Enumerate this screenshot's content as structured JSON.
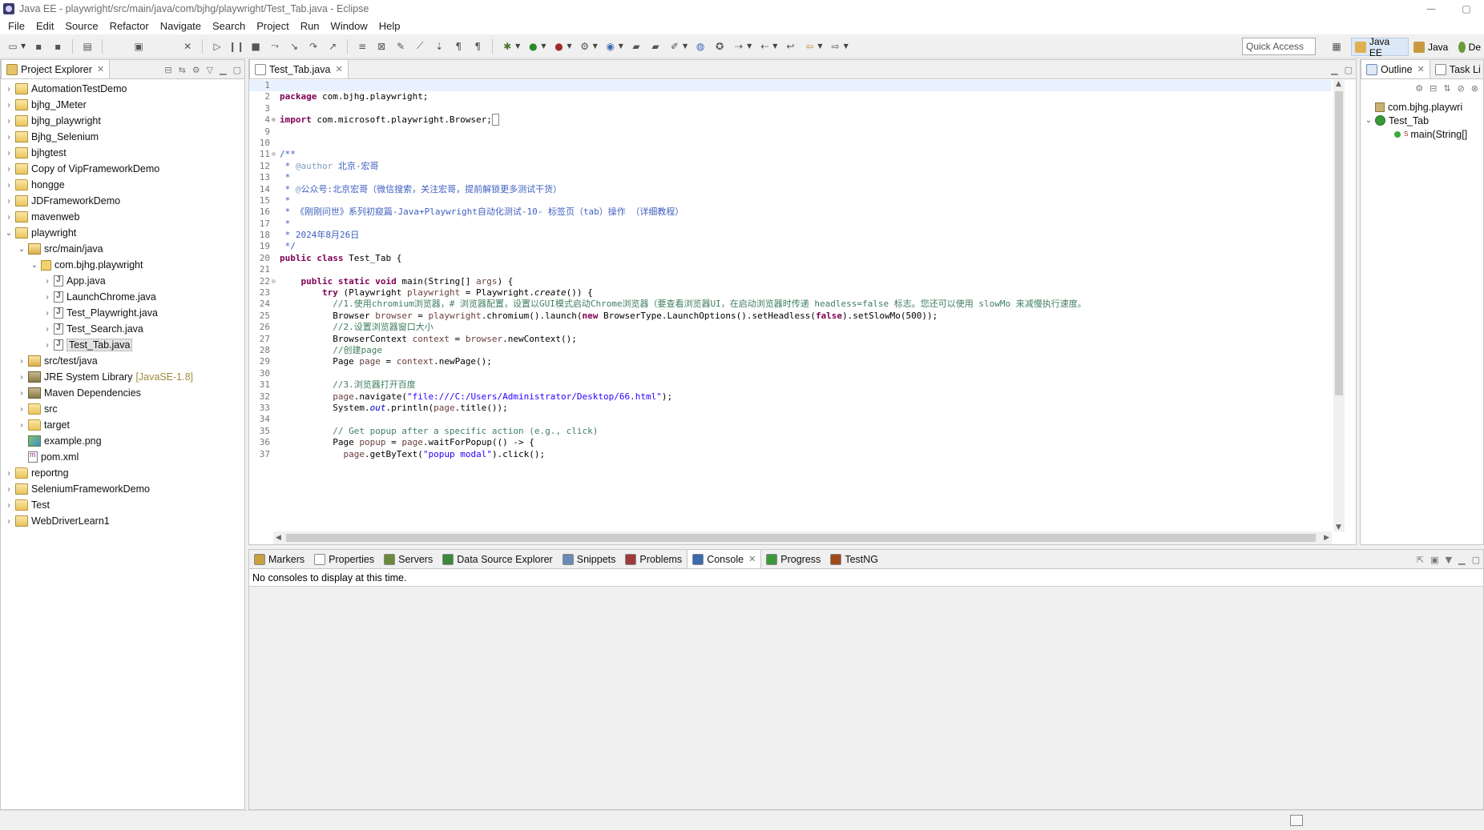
{
  "window": {
    "title": "Java EE - playwright/src/main/java/com/bjhg/playwright/Test_Tab.java - Eclipse",
    "minimize": "—",
    "maximize": "▢"
  },
  "menu": [
    "File",
    "Edit",
    "Source",
    "Refactor",
    "Navigate",
    "Search",
    "Project",
    "Run",
    "Window",
    "Help"
  ],
  "toolbar": {
    "quick_access_placeholder": "Quick Access",
    "perspectives": [
      {
        "label": "Java EE",
        "active": true
      },
      {
        "label": "Java",
        "active": false
      },
      {
        "label": "De",
        "active": false
      }
    ]
  },
  "project_explorer": {
    "tab_label": "Project Explorer",
    "items": [
      {
        "label": "AutomationTestDemo",
        "depth": 0,
        "arrow": "›",
        "icon": "project"
      },
      {
        "label": "bjhg_JMeter",
        "depth": 0,
        "arrow": "›",
        "icon": "project"
      },
      {
        "label": "bjhg_playwright",
        "depth": 0,
        "arrow": "›",
        "icon": "project"
      },
      {
        "label": "Bjhg_Selenium",
        "depth": 0,
        "arrow": "›",
        "icon": "project-err"
      },
      {
        "label": "bjhgtest",
        "depth": 0,
        "arrow": "›",
        "icon": "project"
      },
      {
        "label": "Copy of VipFrameworkDemo",
        "depth": 0,
        "arrow": "›",
        "icon": "project"
      },
      {
        "label": "hongge",
        "depth": 0,
        "arrow": "›",
        "icon": "folder"
      },
      {
        "label": "JDFrameworkDemo",
        "depth": 0,
        "arrow": "›",
        "icon": "project"
      },
      {
        "label": "mavenweb",
        "depth": 0,
        "arrow": "›",
        "icon": "project"
      },
      {
        "label": "playwright",
        "depth": 0,
        "arrow": "⌄",
        "icon": "project"
      },
      {
        "label": "src/main/java",
        "depth": 1,
        "arrow": "⌄",
        "icon": "srcfolder"
      },
      {
        "label": "com.bjhg.playwright",
        "depth": 2,
        "arrow": "⌄",
        "icon": "package"
      },
      {
        "label": "App.java",
        "depth": 3,
        "arrow": "›",
        "icon": "java"
      },
      {
        "label": "LaunchChrome.java",
        "depth": 3,
        "arrow": "›",
        "icon": "java"
      },
      {
        "label": "Test_Playwright.java",
        "depth": 3,
        "arrow": "›",
        "icon": "java"
      },
      {
        "label": "Test_Search.java",
        "depth": 3,
        "arrow": "›",
        "icon": "java"
      },
      {
        "label": "Test_Tab.java",
        "depth": 3,
        "arrow": "›",
        "icon": "java",
        "selected": true
      },
      {
        "label": "src/test/java",
        "depth": 1,
        "arrow": "›",
        "icon": "srcfolder"
      },
      {
        "label": "JRE System Library",
        "extra": "[JavaSE-1.8]",
        "depth": 1,
        "arrow": "›",
        "icon": "lib"
      },
      {
        "label": "Maven Dependencies",
        "depth": 1,
        "arrow": "›",
        "icon": "lib"
      },
      {
        "label": "src",
        "depth": 1,
        "arrow": "›",
        "icon": "folder"
      },
      {
        "label": "target",
        "depth": 1,
        "arrow": "›",
        "icon": "folder"
      },
      {
        "label": "example.png",
        "depth": 1,
        "arrow": "",
        "icon": "img"
      },
      {
        "label": "pom.xml",
        "depth": 1,
        "arrow": "",
        "icon": "xml"
      },
      {
        "label": "reportng",
        "depth": 0,
        "arrow": "›",
        "icon": "folder"
      },
      {
        "label": "SeleniumFrameworkDemo",
        "depth": 0,
        "arrow": "›",
        "icon": "project"
      },
      {
        "label": "Test",
        "depth": 0,
        "arrow": "›",
        "icon": "folder"
      },
      {
        "label": "WebDriverLearn1",
        "depth": 0,
        "arrow": "›",
        "icon": "project"
      }
    ]
  },
  "editor": {
    "tab_label": "Test_Tab.java",
    "lines": [
      {
        "n": "1",
        "fold": "",
        "html": ""
      },
      {
        "n": "2",
        "fold": "",
        "html": "<span class=\"kw\">package</span> com.bjhg.playwright;"
      },
      {
        "n": "3",
        "fold": "",
        "html": ""
      },
      {
        "n": "4",
        "fold": "⊕",
        "html": "<span class=\"kw\">import</span> com.microsoft.playwright.Browser;<span style=\"border:1px solid #888\">&nbsp;</span>"
      },
      {
        "n": "9",
        "fold": "",
        "html": ""
      },
      {
        "n": "10",
        "fold": "",
        "html": ""
      },
      {
        "n": "11",
        "fold": "⊖",
        "html": "<span class=\"jd\">/**</span>"
      },
      {
        "n": "12",
        "fold": "",
        "html": "<span class=\"jd\"> * <span class=\"tag\">@author</span> 北京-宏哥</span>"
      },
      {
        "n": "13",
        "fold": "",
        "html": "<span class=\"jd\"> *</span>"
      },
      {
        "n": "14",
        "fold": "",
        "html": "<span class=\"jd\"> * <span class=\"tag\">@</span>公众号:北京宏哥（微信搜索，关注宏哥，提前解锁更多测试干货）</span>"
      },
      {
        "n": "15",
        "fold": "",
        "html": "<span class=\"jd\"> *</span>"
      },
      {
        "n": "16",
        "fold": "",
        "html": "<span class=\"jd\"> * 《刚刚问世》系列初窥篇-Java+Playwright自动化测试-10- 标签页（tab）操作 （详细教程）</span>"
      },
      {
        "n": "17",
        "fold": "",
        "html": "<span class=\"jd\"> *</span>"
      },
      {
        "n": "18",
        "fold": "",
        "html": "<span class=\"jd\"> * 2024年8月26日</span>"
      },
      {
        "n": "19",
        "fold": "",
        "html": "<span class=\"jd\"> */</span>"
      },
      {
        "n": "20",
        "fold": "",
        "html": "<span class=\"kw\">public class</span> Test_Tab {"
      },
      {
        "n": "21",
        "fold": "",
        "html": ""
      },
      {
        "n": "22",
        "fold": "⊖",
        "html": "    <span class=\"kw\">public static void</span> main(String[] <span class=\"var\">args</span>) {"
      },
      {
        "n": "23",
        "fold": "",
        "html": "        <span class=\"kw\">try</span> (Playwright <span class=\"var\">playwright</span> = Playwright.<i>create</i>()) {"
      },
      {
        "n": "24",
        "fold": "",
        "html": "          <span class=\"cm\">//1.使用chromium浏览器，# 浏览器配置，设置以GUI模式启动Chrome浏览器（要查看浏览器UI，在启动浏览器时传递 headless=false 标志。您还可以使用 slowMo 来减慢执行速度。</span>"
      },
      {
        "n": "25",
        "fold": "",
        "html": "          Browser <span class=\"var\">browser</span> = <span class=\"var\">playwright</span>.chromium().launch(<span class=\"kw\">new</span> BrowserType.LaunchOptions().setHeadless(<span class=\"kw\">false</span>).setSlowMo(500));"
      },
      {
        "n": "26",
        "fold": "",
        "html": "          <span class=\"cm\">//2.设置浏览器窗口大小</span>"
      },
      {
        "n": "27",
        "fold": "",
        "html": "          BrowserContext <span class=\"var\">context</span> = <span class=\"var\">browser</span>.newContext();"
      },
      {
        "n": "28",
        "fold": "",
        "html": "          <span class=\"cm\">//创建page</span>"
      },
      {
        "n": "29",
        "fold": "",
        "html": "          Page <span class=\"var\">page</span> = <span class=\"var\">context</span>.newPage();"
      },
      {
        "n": "30",
        "fold": "",
        "html": ""
      },
      {
        "n": "31",
        "fold": "",
        "html": "          <span class=\"cm\">//3.浏览器打开百度</span>"
      },
      {
        "n": "32",
        "fold": "",
        "html": "          <span class=\"var\">page</span>.navigate(<span class=\"str\">\"file:///C:/Users/Administrator/Desktop/66.html\"</span>);"
      },
      {
        "n": "33",
        "fold": "",
        "html": "          System.<span class=\"fld\">out</span>.println(<span class=\"var\">page</span>.title());"
      },
      {
        "n": "34",
        "fold": "",
        "html": ""
      },
      {
        "n": "35",
        "fold": "",
        "html": "          <span class=\"cm\">// Get popup after a specific action (e.g., click)</span>"
      },
      {
        "n": "36",
        "fold": "",
        "html": "          Page <span class=\"var\">popup</span> = <span class=\"var\">page</span>.waitForPopup(() -> {"
      },
      {
        "n": "37",
        "fold": "",
        "html": "            <span class=\"var\">page</span>.getByText(<span class=\"str\">\"popup modal\"</span>).click();"
      }
    ]
  },
  "outline": {
    "tab_label": "Outline",
    "task_tab_label": "Task Li",
    "items": [
      {
        "label": "com.bjhg.playwri",
        "depth": 0,
        "arrow": "",
        "icon": "package"
      },
      {
        "label": "Test_Tab",
        "depth": 0,
        "arrow": "⌄",
        "icon": "class"
      },
      {
        "label": "main(String[]",
        "depth": 1,
        "arrow": "",
        "icon": "method",
        "super": "S"
      }
    ]
  },
  "bottom": {
    "tabs": [
      {
        "label": "Markers",
        "active": false
      },
      {
        "label": "Properties",
        "active": false
      },
      {
        "label": "Servers",
        "active": false
      },
      {
        "label": "Data Source Explorer",
        "active": false
      },
      {
        "label": "Snippets",
        "active": false
      },
      {
        "label": "Problems",
        "active": false
      },
      {
        "label": "Console",
        "active": true
      },
      {
        "label": "Progress",
        "active": false
      },
      {
        "label": "TestNG",
        "active": false
      }
    ],
    "console_message": "No consoles to display at this time."
  },
  "colors": {
    "keyword": "#7f0055",
    "comment": "#3f7f5f",
    "javadoc": "#3f5fbf",
    "string": "#2a00ff"
  }
}
